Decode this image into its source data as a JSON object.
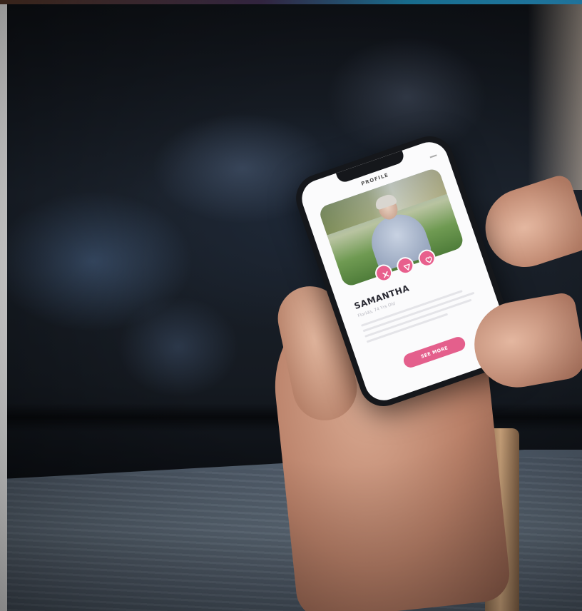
{
  "screen": {
    "title": "PROFILE",
    "profile": {
      "name": "SAMANTHA",
      "subtitle": "Florida, 74 Yrs Old"
    },
    "actions": {
      "dislike_icon": "close-icon",
      "message_icon": "send-icon",
      "like_icon": "heart-icon"
    },
    "see_more_label": "SEE MORE"
  },
  "colors": {
    "accent": "#e45f8c",
    "screen_bg": "#fbfbfc",
    "phone_frame": "#15171b"
  }
}
